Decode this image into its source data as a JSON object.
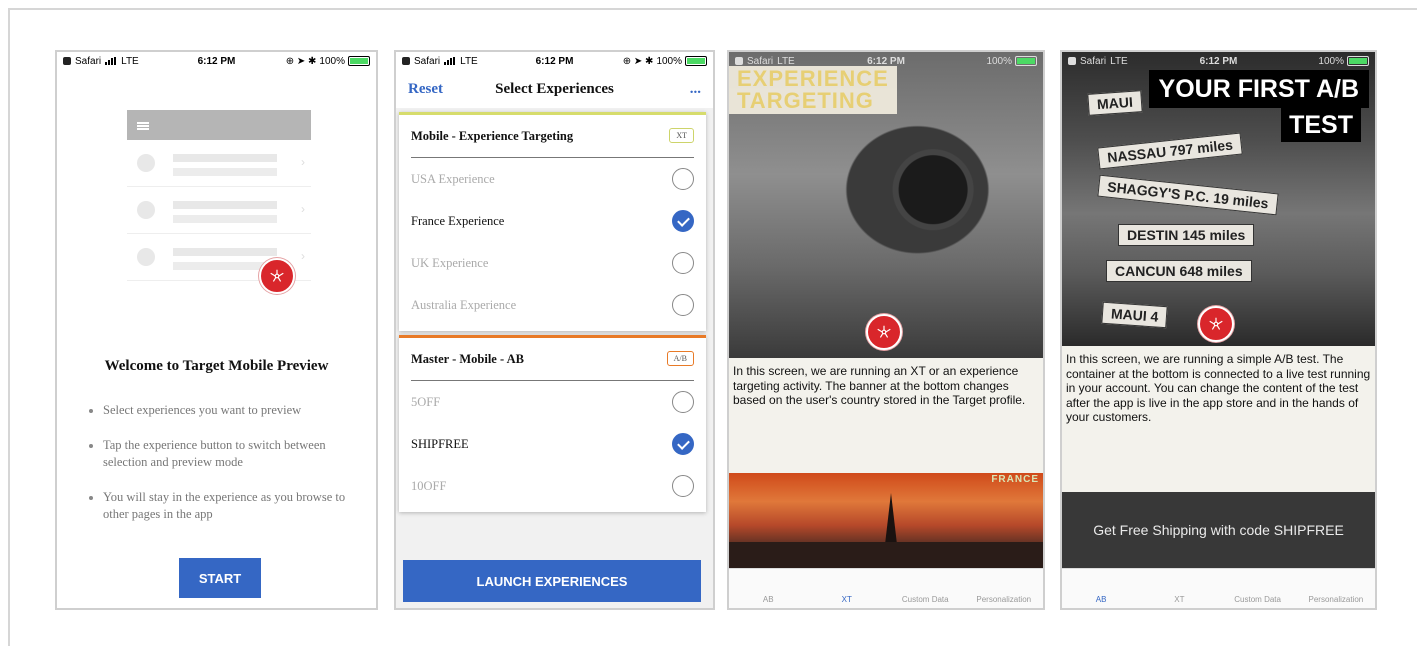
{
  "status": {
    "carrier": "Safari",
    "network": "LTE",
    "time": "6:12 PM",
    "battery": "100%"
  },
  "phone1": {
    "welcome": "Welcome to Target Mobile Preview",
    "bullets": [
      "Select experiences you want to preview",
      "Tap the experience button to switch between selection and preview mode",
      "You will stay in the experience as you browse to other pages in the app"
    ],
    "start_label": "START"
  },
  "phone2": {
    "reset_label": "Reset",
    "title": "Select Experiences",
    "more_label": "...",
    "groups": [
      {
        "name": "Mobile - Experience Targeting",
        "tag": "XT",
        "items": [
          {
            "label": "USA Experience",
            "checked": false
          },
          {
            "label": "France Experience",
            "checked": true
          },
          {
            "label": "UK Experience",
            "checked": false
          },
          {
            "label": "Australia Experience",
            "checked": false
          }
        ]
      },
      {
        "name": "Master - Mobile - AB",
        "tag": "A/B",
        "items": [
          {
            "label": "5OFF",
            "checked": false
          },
          {
            "label": "SHIPFREE",
            "checked": true
          },
          {
            "label": "10OFF",
            "checked": false
          }
        ]
      }
    ],
    "launch_label": "LAUNCH EXPERIENCES"
  },
  "phone3": {
    "title_line1": "EXPERIENCE",
    "title_line2": "TARGETING",
    "description": "In this screen, we are running an XT or an experience targeting activity. The banner at the bottom changes based on the user's country stored in the Target profile.",
    "banner_label": "FRANCE"
  },
  "phone4": {
    "title_line1": "YOUR FIRST A/B",
    "title_line2": "TEST",
    "signs": [
      "MAUI",
      "NASSAU 797 miles",
      "SHAGGY'S P.C. 19 miles",
      "DESTIN 145 miles",
      "CANCUN 648 miles",
      "MAUI 4"
    ],
    "description": "In this screen, we are running a simple A/B test. The container at the bottom is connected to a live test running in your account.  You can change the content of the test after the app is live in the app store and in the hands of your customers.",
    "banner_text": "Get Free Shipping with code SHIPFREE"
  },
  "tabs": [
    "AB",
    "XT",
    "Custom Data",
    "Personalization"
  ],
  "colors": {
    "accent": "#3567c4",
    "badge": "#d9262b",
    "xt_stripe": "#d6dc6c",
    "ab_stripe": "#e87a27"
  }
}
